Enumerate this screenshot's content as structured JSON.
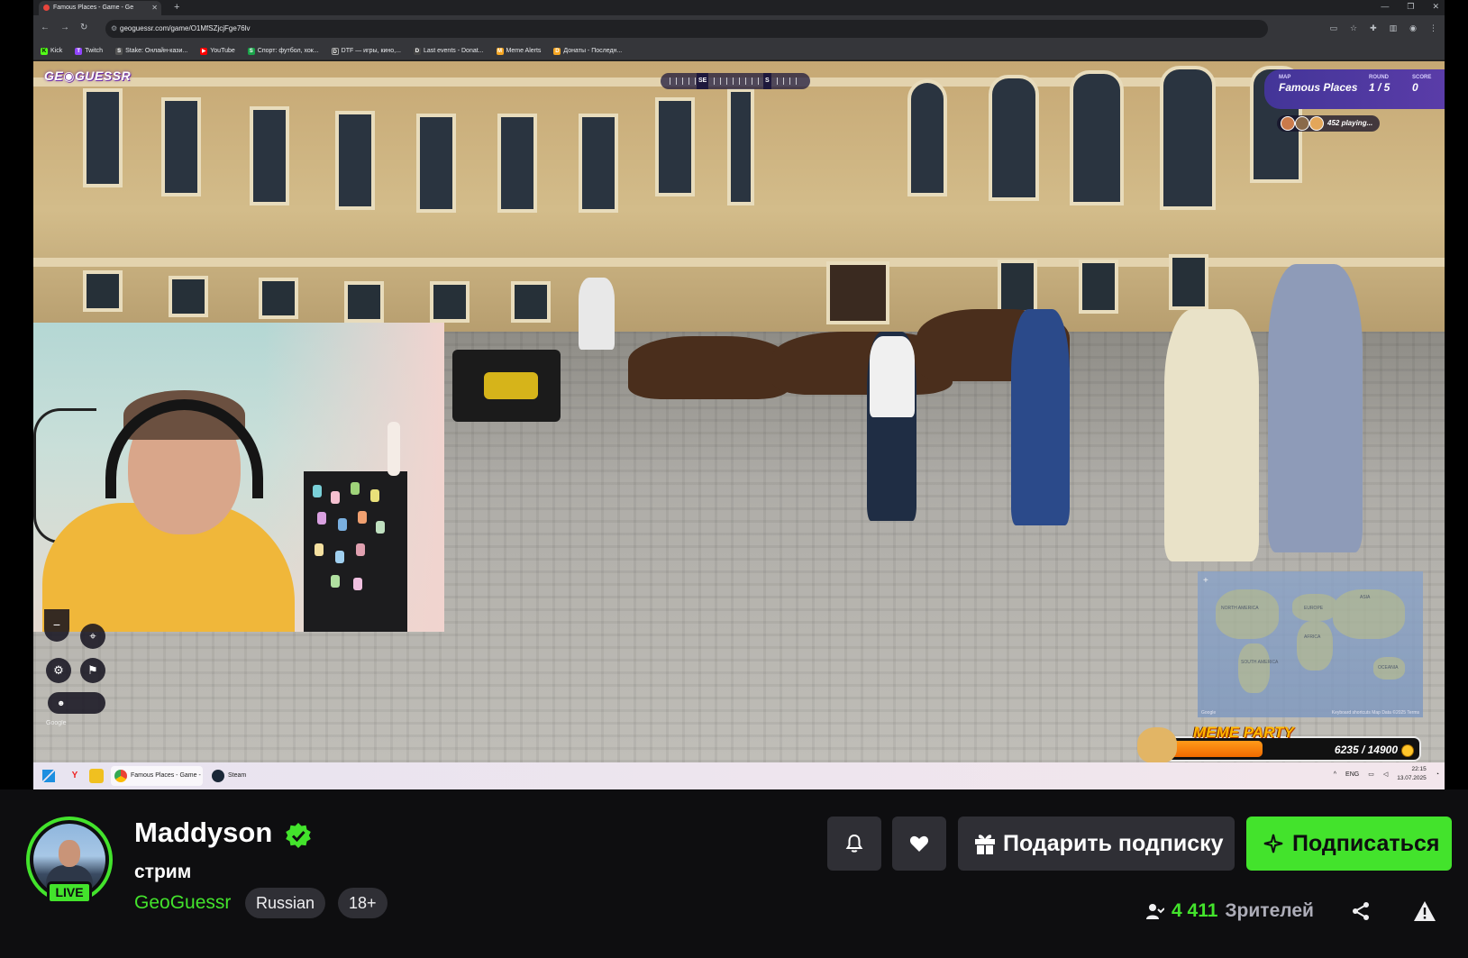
{
  "browser": {
    "tab_title": "Famous Places - Game - Ge",
    "url": "geoguessr.com/game/O1MfSZjcjFge76lv",
    "bookmarks": [
      {
        "label": "Kick",
        "color": "#53fc18"
      },
      {
        "label": "Twitch",
        "color": "#9146ff"
      },
      {
        "label": "Stake: Онлайн-кази...",
        "color": "#555555"
      },
      {
        "label": "YouTube",
        "color": "#ff0000"
      },
      {
        "label": "Спорт: футбол, хок...",
        "color": "#1aa34a"
      },
      {
        "label": "DTF — игры, кино,...",
        "color": "#333333"
      },
      {
        "label": "Last events - Donat...",
        "color": "#444444"
      },
      {
        "label": "Meme Alerts",
        "color": "#f5a623"
      },
      {
        "label": "Донаты - Последн...",
        "color": "#f5a623"
      }
    ]
  },
  "game": {
    "logo": "GE◉GUESSR",
    "compass": {
      "left_dir": "SE",
      "right_dir": "S"
    },
    "map_label": "MAP",
    "map_value": "Famous Places",
    "round_label": "ROUND",
    "round_value": "1 / 5",
    "score_label": "SCORE",
    "score_value": "0",
    "playing": "452 playing...",
    "google": "Google",
    "minimap": {
      "labels": [
        "NORTH AMERICA",
        "EUROPE",
        "ASIA",
        "AFRICA",
        "SOUTH AMERICA",
        "OCEANIA"
      ],
      "footer_google": "Google",
      "footer_right": "Keyboard shortcuts  Map Data ©2025  Terms"
    }
  },
  "meme_party": {
    "title": "MEME PARTY",
    "progress": "6235 / 14900",
    "progress_fraction": 0.418
  },
  "taskbar": {
    "apps": [
      {
        "label": "Famous Places - Game -",
        "active": true
      },
      {
        "label": "Steam",
        "active": false
      }
    ],
    "lang": "ENG",
    "time": "22:15",
    "date": "13.07.2025"
  },
  "channel": {
    "name": "Maddyson",
    "live": "LIVE",
    "title": "стрим",
    "category": "GeoGuessr",
    "tags": [
      "Russian",
      "18+"
    ],
    "gift_label": "Подарить подписку",
    "subscribe_label": "Подписаться",
    "viewers_count": "4 411",
    "viewers_label": "Зрителей",
    "accent": "#43e32c"
  }
}
